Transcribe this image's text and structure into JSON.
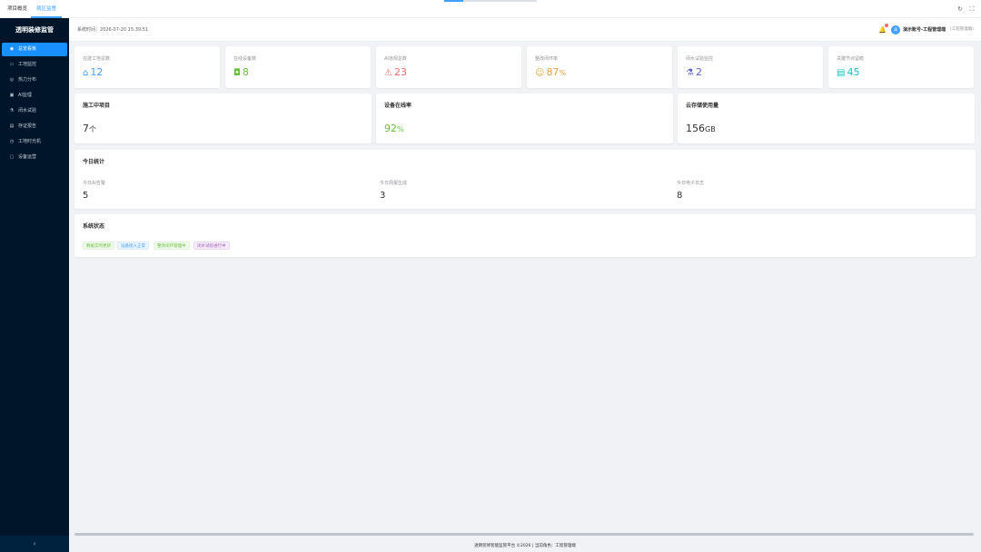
{
  "tabs": [
    {
      "label": "项目概览"
    },
    {
      "label": "病区监督"
    }
  ],
  "sidebar": {
    "logo": "透明装修监管",
    "items": [
      {
        "label": "总览看板",
        "icon": "dashboard-icon"
      },
      {
        "label": "工地监控",
        "icon": "camera-icon"
      },
      {
        "label": "热力分布",
        "icon": "heatmap-icon"
      },
      {
        "label": "AI监理",
        "icon": "ai-icon"
      },
      {
        "label": "闭水试验",
        "icon": "flask-icon"
      },
      {
        "label": "存证报告",
        "icon": "report-icon"
      },
      {
        "label": "工地时光机",
        "icon": "clock-icon"
      },
      {
        "label": "设备运营",
        "icon": "device-icon"
      }
    ],
    "collapse_glyph": "‹"
  },
  "header": {
    "sys_time_label": "系统时间：",
    "sys_time": "2026-07-20 15:39:51",
    "avatar_text": "演",
    "user_name": "演示账号-工程管理端",
    "user_role": "(工程管理端)"
  },
  "stats": [
    {
      "label": "在建工地总数",
      "value": "12",
      "color": "#409eff",
      "icon": "home-icon",
      "glyph": "⌂"
    },
    {
      "label": "在线设备数",
      "value": "8",
      "color": "#67c23a",
      "icon": "camera-icon",
      "glyph": "◘"
    },
    {
      "label": "AI违规总数",
      "value": "23",
      "color": "#f56c6c",
      "icon": "alarm-icon",
      "glyph": "⚠"
    },
    {
      "label": "整改闭环率",
      "value": "87",
      "unit": "%",
      "color": "#e6a23c",
      "icon": "smile-icon",
      "glyph": "☺"
    },
    {
      "label": "闭水试验监控",
      "value": "2",
      "color": "#5b5fc7",
      "icon": "flask-icon",
      "glyph": "⚗"
    },
    {
      "label": "关键节点留痕",
      "value": "45",
      "color": "#13c2c2",
      "icon": "document-icon",
      "glyph": "▤"
    }
  ],
  "metrics": [
    {
      "title": "施工中项目",
      "value": "7",
      "unit": "个",
      "color": "#303133"
    },
    {
      "title": "设备在线率",
      "value": "92",
      "unit": "%",
      "color": "#67c23a"
    },
    {
      "title": "云存储使用量",
      "value": "156",
      "unit": "GB",
      "color": "#303133"
    }
  ],
  "today": {
    "title": "今日统计",
    "items": [
      {
        "label": "今日AI告警",
        "value": "5"
      },
      {
        "label": "今日周报生成",
        "value": "3"
      },
      {
        "label": "今日电子日志",
        "value": "8"
      }
    ]
  },
  "system": {
    "title": "系统状态",
    "tags": [
      {
        "label": "数据实时更新",
        "color": "green"
      },
      {
        "label": "设备接入正常",
        "color": "blue"
      },
      {
        "label": "整改闭环管理中",
        "color": "green"
      },
      {
        "label": "闭水试验进行中",
        "color": "purple"
      }
    ]
  },
  "footer": "透明装修智能监管平台 ©2026 | 当前角色：工程管理端"
}
